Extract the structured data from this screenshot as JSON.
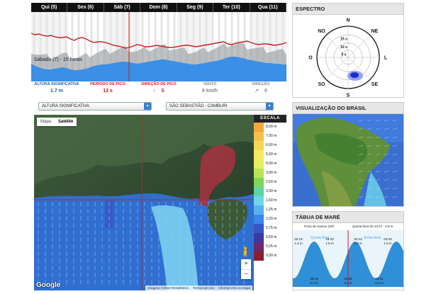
{
  "forecast": {
    "days": [
      "Qui (5)",
      "Sex (6)",
      "Sáb (7)",
      "Dom (8)",
      "Seg (9)",
      "Ter (10)",
      "Qua (11)"
    ],
    "hover_caption": "Sábado (7) - 15 horas",
    "colors": {
      "period_line": "#c82020",
      "height_area": "#3b8fe6",
      "direction_area": "#8a8f96",
      "cursor": "#c81e1e"
    },
    "period_line_values": [
      30,
      32,
      31,
      33,
      34,
      33,
      35,
      36,
      36,
      35,
      38,
      40,
      37,
      36,
      38,
      41,
      43,
      42,
      42,
      43,
      45,
      47,
      48,
      49,
      51,
      50,
      48,
      46,
      47,
      49,
      49,
      48,
      47,
      48,
      49,
      50,
      50,
      49,
      48,
      47,
      47,
      48,
      49,
      48,
      47,
      46,
      45,
      44,
      43,
      42,
      45,
      46,
      44,
      43,
      42,
      41,
      43,
      45,
      46,
      45,
      45,
      46,
      47,
      46,
      45,
      43
    ],
    "height_area_values": [
      25,
      22,
      20,
      18,
      17,
      17,
      18,
      19,
      20,
      19,
      17,
      16,
      16,
      17,
      18,
      20,
      22,
      23,
      24,
      24,
      25,
      26,
      27,
      28,
      28,
      27,
      26,
      25,
      26,
      27,
      28,
      29,
      30,
      31,
      31,
      30,
      29,
      28,
      27,
      26,
      25,
      24,
      24,
      25,
      26,
      27,
      28,
      29,
      30,
      32,
      34,
      35,
      35,
      34,
      33,
      31,
      30,
      29,
      28,
      27,
      26,
      26,
      25,
      25,
      24,
      24
    ]
  },
  "metrics": [
    {
      "label": "ALTURA SIGNIFICATIVA",
      "value": "1.7 m",
      "color": "#1a5fb4"
    },
    {
      "label": "PERÍODO DE PICO",
      "value": "12 s",
      "color": "#c81e1e"
    },
    {
      "label": "DIREÇÃO DE PICO",
      "icon": "arrow-up-icon",
      "value": "S",
      "color": "#c81e1e"
    },
    {
      "label": "VENTO",
      "value": "9 km/h",
      "color": "#888888"
    },
    {
      "label": "DIREÇÃO",
      "icon": "arrow-up-right-icon",
      "value": "0",
      "color": "#888888"
    }
  ],
  "selects": {
    "variable": "ALTURA SIGNIFICATIVA",
    "location": "SÃO SEBASTIÃO - CAMBURI"
  },
  "map": {
    "toggle": [
      "Mapa",
      "Satélite"
    ],
    "active_toggle": "Satélite",
    "zoom_in": "+",
    "zoom_out": "−",
    "google_logo": "Google",
    "attribution": [
      "Imagens ©2016 TerraMetrics",
      "Termos de Uso",
      "Informar erro no mapa"
    ]
  },
  "scale": {
    "title": "ESCALA",
    "items": [
      {
        "label": "8,00 m",
        "color": "#f4a83a"
      },
      {
        "label": "7,00 m",
        "color": "#f6c04c"
      },
      {
        "label": "6,00 m",
        "color": "#f7d45a"
      },
      {
        "label": "5,00 m",
        "color": "#f4ea62"
      },
      {
        "label": "4,00 m",
        "color": "#e6ef64"
      },
      {
        "label": "3,00 m",
        "color": "#b8e35a"
      },
      {
        "label": "2,50 m",
        "color": "#7ed65a"
      },
      {
        "label": "2,00 m",
        "color": "#5fd3a8"
      },
      {
        "label": "1,50 m",
        "color": "#6fd6ea"
      },
      {
        "label": "1,25 m",
        "color": "#5ab0f0"
      },
      {
        "label": "1,00 m",
        "color": "#3b86e8"
      },
      {
        "label": "0,75 m",
        "color": "#3a55c6"
      },
      {
        "label": "0,50 m",
        "color": "#3c3a9e"
      },
      {
        "label": "0,25 m",
        "color": "#6a2a70"
      },
      {
        "label": "0,00 m",
        "color": "#8a1f30"
      }
    ]
  },
  "spectrum": {
    "title": "ESPECTRO",
    "directions": [
      "N",
      "NE",
      "L",
      "SE",
      "S",
      "SO",
      "O",
      "NO"
    ],
    "period_rings": [
      "15 s",
      "10 s",
      "5 s"
    ]
  },
  "brasil": {
    "title": "VISUALIZAÇÃO DO BRASIL"
  },
  "tide": {
    "title": "TÁBUA DE MARÉ",
    "location": "Porto de Santos (SP)",
    "updated": "Quinta-feira 00 23:47 - 0.8 m",
    "day_labels": [
      "Quinta-feira",
      "Sexta-feira"
    ],
    "highs": [
      {
        "time": "02:13",
        "height": "1.4 m"
      },
      {
        "time": "16:43",
        "height": "1.5 m"
      },
      {
        "time": "02:13",
        "height": "1.3 m"
      },
      {
        "time": "03:23",
        "height": "1.5 m"
      }
    ],
    "lows": [
      {
        "time": "08:13",
        "height": "0.2 m"
      },
      {
        "time": "20:35",
        "height": "0.1 m"
      },
      {
        "time": "08:51",
        "height": "0.2 m"
      }
    ],
    "colors": {
      "water": "#2f8fd8",
      "water_light": "#8cc6f0",
      "cursor": "#c81e1e"
    }
  }
}
